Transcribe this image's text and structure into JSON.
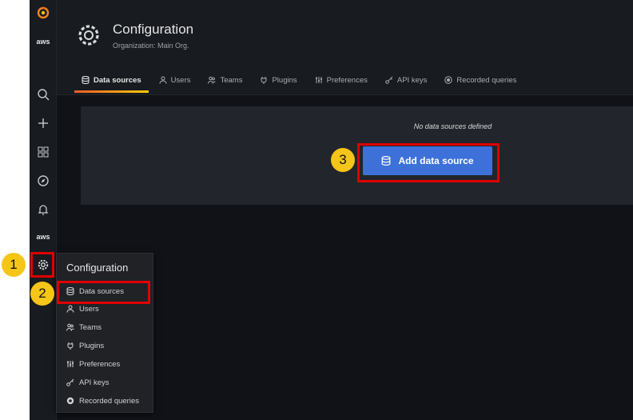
{
  "sidebar": {
    "icons": [
      "grafana-logo-icon",
      "aws-icon",
      "search-icon",
      "plus-icon",
      "dashboards-icon",
      "explore-icon",
      "alerting-icon",
      "aws-icon",
      "gear-icon"
    ],
    "brand_text_top": "aws",
    "brand_text_bottom": "aws"
  },
  "header": {
    "title": "Configuration",
    "subtitle": "Organization: Main Org."
  },
  "tabs": [
    {
      "label": "Data sources",
      "icon": "database-icon",
      "active": true
    },
    {
      "label": "Users",
      "icon": "user-icon"
    },
    {
      "label": "Teams",
      "icon": "users-icon"
    },
    {
      "label": "Plugins",
      "icon": "plug-icon"
    },
    {
      "label": "Preferences",
      "icon": "sliders-icon"
    },
    {
      "label": "API keys",
      "icon": "key-icon"
    },
    {
      "label": "Recorded queries",
      "icon": "record-icon"
    }
  ],
  "main": {
    "empty_message": "No data sources defined",
    "add_button": "Add data source"
  },
  "menu": {
    "title": "Configuration",
    "items": [
      {
        "label": "Data sources",
        "icon": "database-icon"
      },
      {
        "label": "Users",
        "icon": "user-icon"
      },
      {
        "label": "Teams",
        "icon": "users-icon"
      },
      {
        "label": "Plugins",
        "icon": "plug-icon"
      },
      {
        "label": "Preferences",
        "icon": "sliders-icon"
      },
      {
        "label": "API keys",
        "icon": "key-icon"
      },
      {
        "label": "Recorded queries",
        "icon": "record-icon"
      }
    ]
  },
  "annotations": [
    "1",
    "2",
    "3"
  ],
  "colors": {
    "accent": "#3d71d9",
    "highlight": "#e00000",
    "badge": "#f5c518",
    "background": "#111217"
  }
}
